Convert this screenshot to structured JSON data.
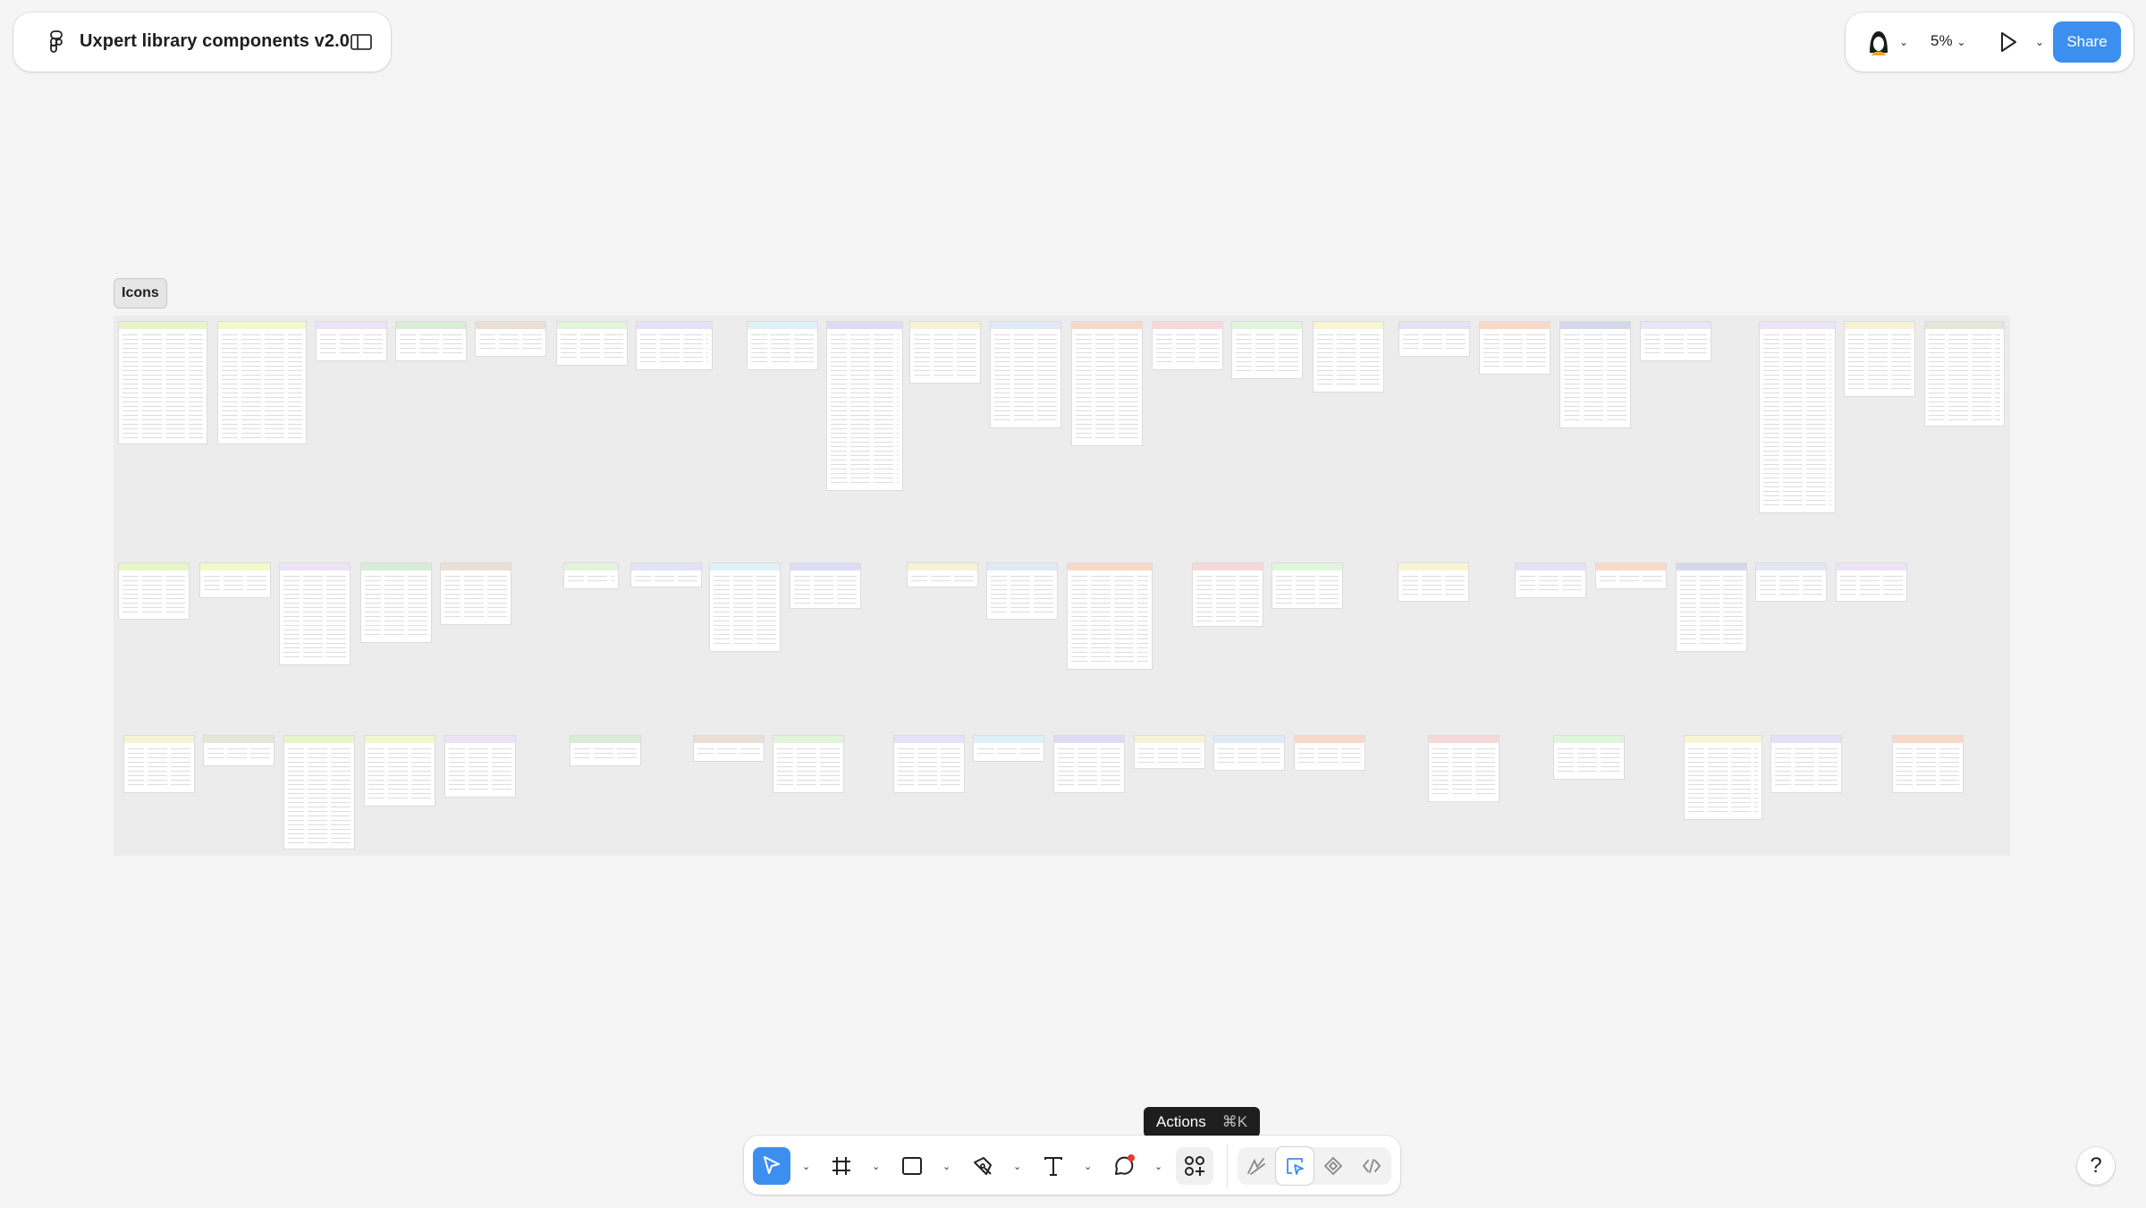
{
  "file": {
    "title": "Uxpert library components v2.0"
  },
  "header": {
    "zoom": "5%",
    "share_label": "Share"
  },
  "canvas": {
    "section_label": "Icons",
    "frame_colors": [
      "#e7f5c8",
      "#f2f8c9",
      "#ece3f7",
      "#d8ecd6",
      "#eadfd6",
      "#e0f4dc",
      "#e3e2f6",
      "#dff1f7",
      "#dcdcf5",
      "#f7f2d6",
      "#e0eaf7",
      "#f7d9c9",
      "#f7d8d8",
      "#e0f6dc",
      "#f8f5d4",
      "#e6e2f5",
      "#f8d9c8",
      "#d5d8ea",
      "#e6e6f6",
      "#ece3f7",
      "#f7f2d4",
      "#e2e8d7"
    ]
  },
  "tooltip": {
    "label": "Actions",
    "shortcut": "⌘K"
  },
  "toolbar": {
    "tools": [
      "move-tool",
      "frame-tool",
      "rectangle-tool",
      "pen-tool",
      "text-tool",
      "comment-tool",
      "actions-tool"
    ],
    "modes": [
      "draw-mode",
      "design-mode",
      "dev-component-mode",
      "dev-mode"
    ]
  },
  "help": {
    "label": "?"
  },
  "colors": {
    "accent": "#3d8fef",
    "canvas_bg": "#f5f5f5",
    "section_bg": "#ececec",
    "tooltip_bg": "#1e1e1e"
  }
}
